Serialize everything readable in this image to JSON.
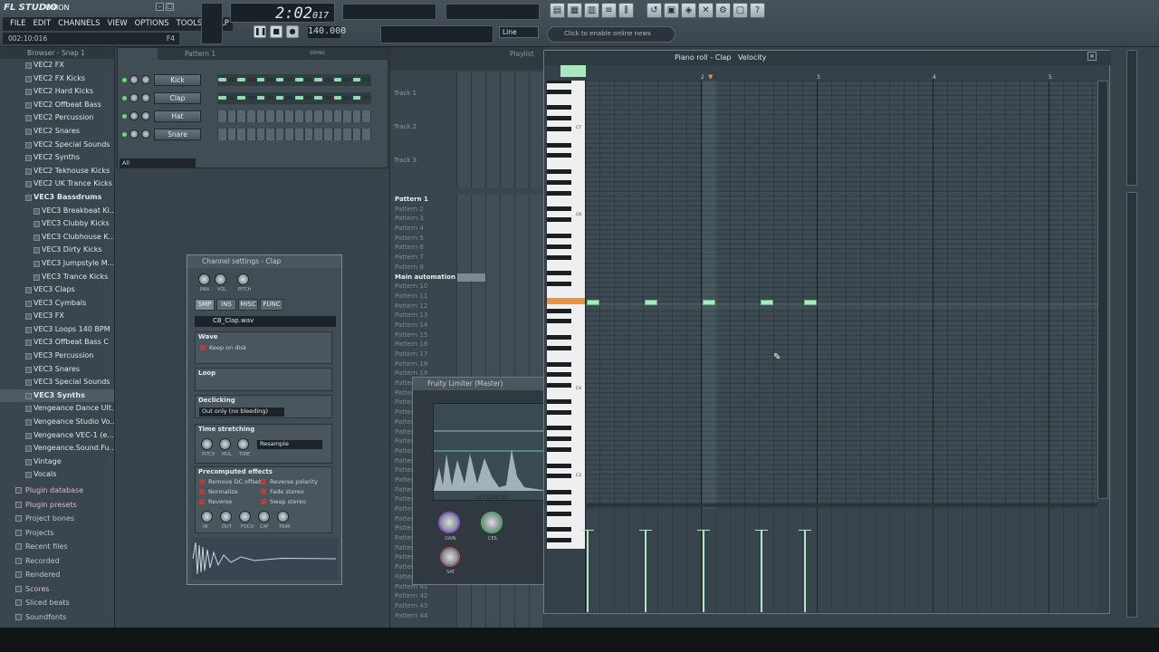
{
  "app": {
    "logo": "FL STUDIO",
    "song": "UNION"
  },
  "menu": [
    "FILE",
    "EDIT",
    "CHANNELS",
    "VIEW",
    "OPTIONS",
    "TOOLS",
    "HELP"
  ],
  "status": {
    "time": "002:10:016",
    "key": "F4"
  },
  "transport": {
    "time": "2:02",
    "ticks": "017",
    "tempo": "140.000",
    "line_mode": "Line",
    "news": "Click to enable online news"
  },
  "browser": {
    "title": "Browser - Snap 1",
    "items": [
      {
        "label": "VEC2 FX",
        "b": false
      },
      {
        "label": "VEC2 FX Kicks",
        "b": false
      },
      {
        "label": "VEC2 Hard Kicks",
        "b": false
      },
      {
        "label": "VEC2 Offbeat Bass",
        "b": false
      },
      {
        "label": "VEC2 Percussion",
        "b": false
      },
      {
        "label": "VEC2 Snares",
        "b": false
      },
      {
        "label": "VEC2 Special Sounds",
        "b": false
      },
      {
        "label": "VEC2 Synths",
        "b": false
      },
      {
        "label": "VEC2 Tekhouse Kicks",
        "b": false
      },
      {
        "label": "VEC2 UK Trance Kicks",
        "b": false
      },
      {
        "label": "VEC3 Bassdrums",
        "b": true
      },
      {
        "label": "VEC3 Breakbeat Ki...",
        "sub": true
      },
      {
        "label": "VEC3 Clubby Kicks",
        "sub": true
      },
      {
        "label": "VEC3 Clubhouse K...",
        "sub": true
      },
      {
        "label": "VEC3 Dirty Kicks",
        "sub": true
      },
      {
        "label": "VEC3 Jumpstyle M...",
        "sub": true
      },
      {
        "label": "VEC3 Trance Kicks",
        "sub": true
      },
      {
        "label": "VEC3 Claps"
      },
      {
        "label": "VEC3 Cymbals"
      },
      {
        "label": "VEC3 FX"
      },
      {
        "label": "VEC3 Loops 140 BPM"
      },
      {
        "label": "VEC3 Offbeat Bass C"
      },
      {
        "label": "VEC3 Percussion"
      },
      {
        "label": "VEC3 Snares"
      },
      {
        "label": "VEC3 Special Sounds"
      },
      {
        "label": "VEC3 Synths",
        "b": true,
        "sel": true
      },
      {
        "label": "Vengeance Dance Ult..."
      },
      {
        "label": "Vengeance Studio Vo..."
      },
      {
        "label": "Vengeance VEC-1 (e..."
      },
      {
        "label": "Vengeance.Sound.Fu..."
      },
      {
        "label": "Vintage"
      },
      {
        "label": "Vocals"
      }
    ],
    "sections": [
      {
        "label": "Plugin database",
        "pink": true
      },
      {
        "label": "Plugin presets",
        "pink": true
      },
      {
        "label": "Project bones"
      },
      {
        "label": "Projects"
      },
      {
        "label": "Recent files"
      },
      {
        "label": "Recorded"
      },
      {
        "label": "Rendered"
      },
      {
        "label": "Scores",
        "pink": true
      },
      {
        "label": "Sliced beats"
      },
      {
        "label": "Soundfonts"
      }
    ]
  },
  "stepseq": {
    "title": "Pattern 1",
    "swing": "SWING",
    "filter": "All",
    "channels": [
      {
        "name": "Kick",
        "graph": true
      },
      {
        "name": "Clap",
        "graph": true
      },
      {
        "name": "Hat"
      },
      {
        "name": "Snare"
      }
    ]
  },
  "chset": {
    "title": "Channel settings - Clap",
    "tabs": [
      "SMP",
      "INS",
      "MISC",
      "FUNC"
    ],
    "sample": "CB_Clap.wav",
    "wave": "Wave",
    "keep": "Keep on disk",
    "loop": "Loop",
    "declick": "Declicking",
    "declick_mode": "Out only (no bleeding)",
    "ts": "Time stretching",
    "ts_mode": "Resample",
    "pre": "Precomputed effects",
    "fx": [
      "Remove DC offset",
      "Normalize",
      "Reverse",
      "Reverse polarity",
      "Fade stereo",
      "Swap stereo"
    ],
    "knobs_top": [
      "PAN",
      "VOL",
      "PITCH"
    ],
    "knobs_ts": [
      "PITCH",
      "MUL",
      "TIME"
    ],
    "knobs_pre": [
      "IN",
      "OUT",
      "FOCO",
      "CAF",
      "TRIM"
    ]
  },
  "playlist": {
    "title": "Playlist",
    "tracks": [
      "Track 1",
      "Track 2",
      "Track 3"
    ],
    "patterns": [
      "Pattern 1",
      "Pattern 2",
      "Pattern 3",
      "Pattern 4",
      "Pattern 5",
      "Pattern 6",
      "Pattern 7",
      "Pattern 8",
      "Main automation",
      "Pattern 10",
      "Pattern 11",
      "Pattern 12",
      "Pattern 13",
      "Pattern 14",
      "Pattern 15",
      "Pattern 16",
      "Pattern 17",
      "Pattern 18",
      "Pattern 19",
      "Pattern 20",
      "Pattern 21",
      "Pattern 22",
      "Pattern 23",
      "Pattern 24",
      "Pattern 25",
      "Pattern 26",
      "Pattern 27",
      "Pattern 28",
      "Pattern 29",
      "Pattern 30",
      "Pattern 31",
      "Pattern 32",
      "Pattern 33",
      "Pattern 34",
      "Pattern 35",
      "Pattern 36",
      "Pattern 37",
      "Pattern 38",
      "Pattern 39",
      "Pattern 40",
      "Pattern 41",
      "Pattern 42",
      "Pattern 43",
      "Pattern 44"
    ]
  },
  "limiter": {
    "title": "Fruity Limiter (Master)",
    "label": "LOUDNESS",
    "knobs": [
      "GAIN",
      "CEIL",
      "SAT"
    ]
  },
  "pianoroll": {
    "title": "Piano roll - Clap",
    "mode": "Velocity",
    "bars": [
      "2",
      "3",
      "4",
      "5"
    ],
    "octaves": [
      "C7",
      "C6",
      "C5",
      "C4",
      "C3"
    ],
    "notes_x": [
      0,
      64,
      128,
      192,
      240
    ]
  }
}
